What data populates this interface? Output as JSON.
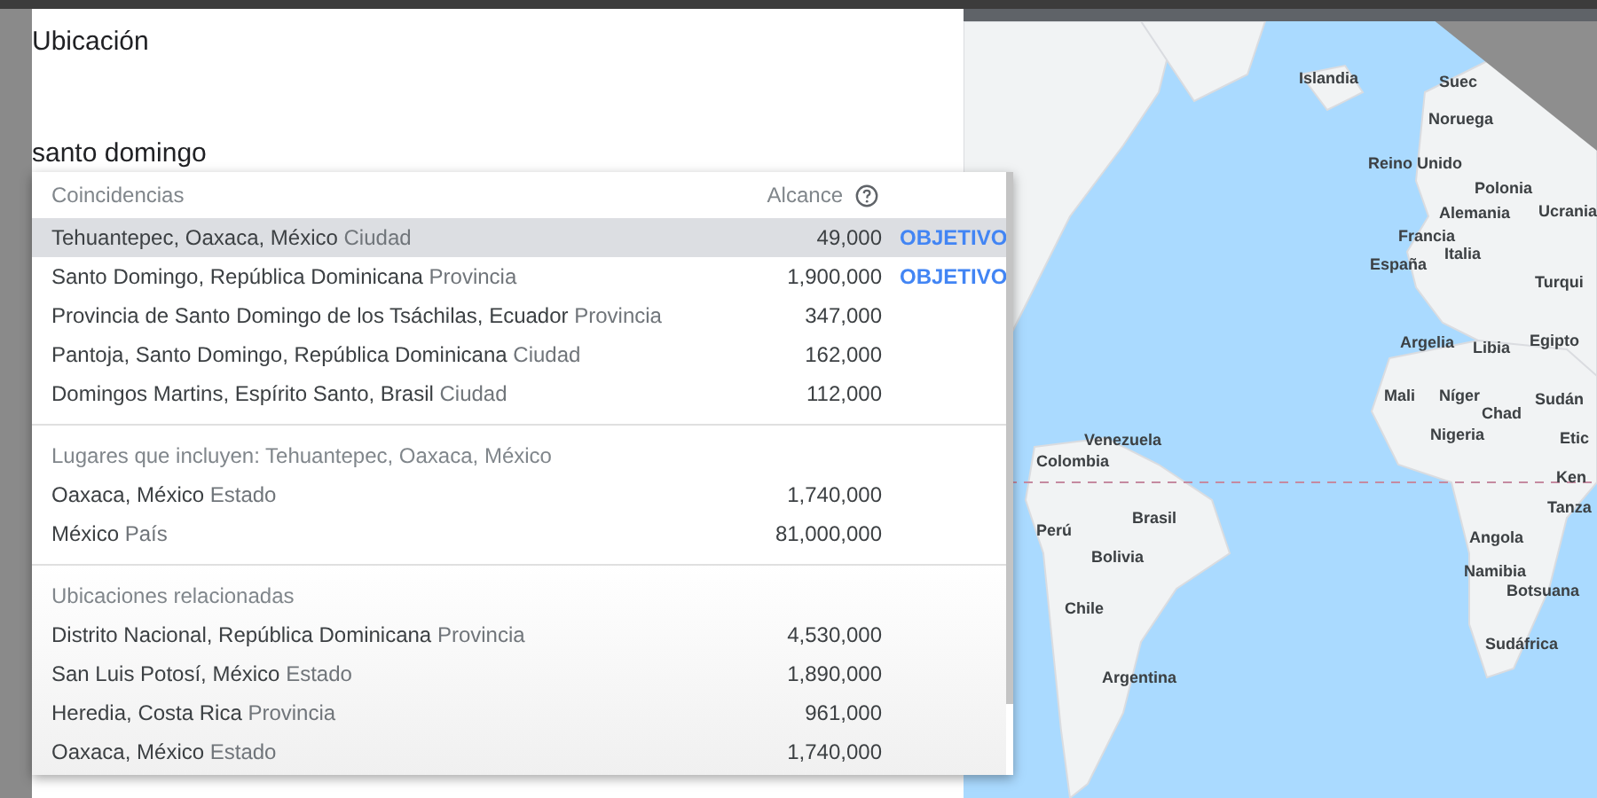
{
  "dialog": {
    "title": "Ubicación",
    "search": {
      "value": "santo domingo"
    }
  },
  "dropdown": {
    "header": {
      "label": "Coincidencias",
      "reach_label": "Alcance"
    },
    "sections": [
      {
        "kind": "matches",
        "items": [
          {
            "name": "Tehuantepec, Oaxaca, México",
            "type": "Ciudad",
            "reach": "49,000",
            "action": "OBJETIVO",
            "selected": true
          },
          {
            "name": "Santo Domingo, República Dominicana",
            "type": "Provincia",
            "reach": "1,900,000",
            "action": "OBJETIVO",
            "selected": false
          },
          {
            "name": "Provincia de Santo Domingo de los Tsáchilas, Ecuador",
            "type": "Provincia",
            "reach": "347,000",
            "selected": false
          },
          {
            "name": "Pantoja, Santo Domingo, República Dominicana",
            "type": "Ciudad",
            "reach": "162,000",
            "selected": false
          },
          {
            "name": "Domingos Martins, Espírito Santo, Brasil",
            "type": "Ciudad",
            "reach": "112,000",
            "selected": false
          }
        ]
      },
      {
        "kind": "group",
        "heading": "Lugares que incluyen: Tehuantepec, Oaxaca, México",
        "items": [
          {
            "name": "Oaxaca, México",
            "type": "Estado",
            "reach": "1,740,000",
            "selected": false
          },
          {
            "name": "México",
            "type": "País",
            "reach": "81,000,000",
            "selected": false
          }
        ]
      },
      {
        "kind": "group",
        "heading": "Ubicaciones relacionadas",
        "items": [
          {
            "name": "Distrito Nacional, República Dominicana",
            "type": "Provincia",
            "reach": "4,530,000",
            "selected": false
          },
          {
            "name": "San Luis Potosí, México",
            "type": "Estado",
            "reach": "1,890,000",
            "selected": false
          },
          {
            "name": "Heredia, Costa Rica",
            "type": "Provincia",
            "reach": "961,000",
            "selected": false
          },
          {
            "name": "Oaxaca, México",
            "type": "Estado",
            "reach": "1,740,000",
            "selected": false
          }
        ]
      }
    ]
  },
  "map": {
    "labels": [
      "Islandia",
      "Suec",
      "Noruega",
      "Reino Unido",
      "Polonia",
      "Alemania",
      "Ucrania",
      "Francia",
      "Italia",
      "España",
      "Turqui",
      "Argelia",
      "Libia",
      "Egipto",
      "Mali",
      "Níger",
      "Chad",
      "Sudán",
      "Nigeria",
      "Etic",
      "Ken",
      "Tanza",
      "Angola",
      "Namibia",
      "Botsuana",
      "Sudáfrica",
      "Venezuela",
      "Colombia",
      "Perú",
      "Brasil",
      "Bolivia",
      "Chile",
      "Argentina"
    ]
  }
}
